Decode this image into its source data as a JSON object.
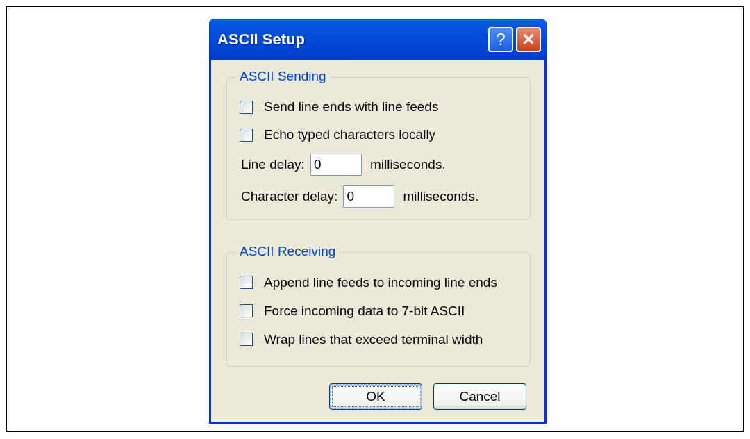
{
  "window": {
    "title": "ASCII Setup",
    "help_button": "?",
    "close_button": "✕"
  },
  "groups": [
    {
      "title": "ASCII Sending",
      "items": [
        {
          "kind": "checkbox",
          "label": "Send line ends with line feeds",
          "checked": false
        },
        {
          "kind": "checkbox",
          "label": "Echo typed characters locally",
          "checked": false
        },
        {
          "kind": "delay",
          "label": "Line delay:",
          "value": "0",
          "unit": "milliseconds."
        },
        {
          "kind": "delay",
          "label": "Character delay:",
          "value": "0",
          "unit": "milliseconds."
        }
      ]
    },
    {
      "title": "ASCII Receiving",
      "items": [
        {
          "kind": "checkbox",
          "label": "Append line feeds to incoming line ends",
          "checked": false
        },
        {
          "kind": "checkbox",
          "label": "Force incoming data to 7-bit ASCII",
          "checked": false
        },
        {
          "kind": "checkbox",
          "label": "Wrap lines that exceed terminal width",
          "checked": false
        }
      ]
    }
  ],
  "buttons": [
    {
      "label": "OK",
      "focused": true
    },
    {
      "label": "Cancel",
      "focused": false
    }
  ]
}
